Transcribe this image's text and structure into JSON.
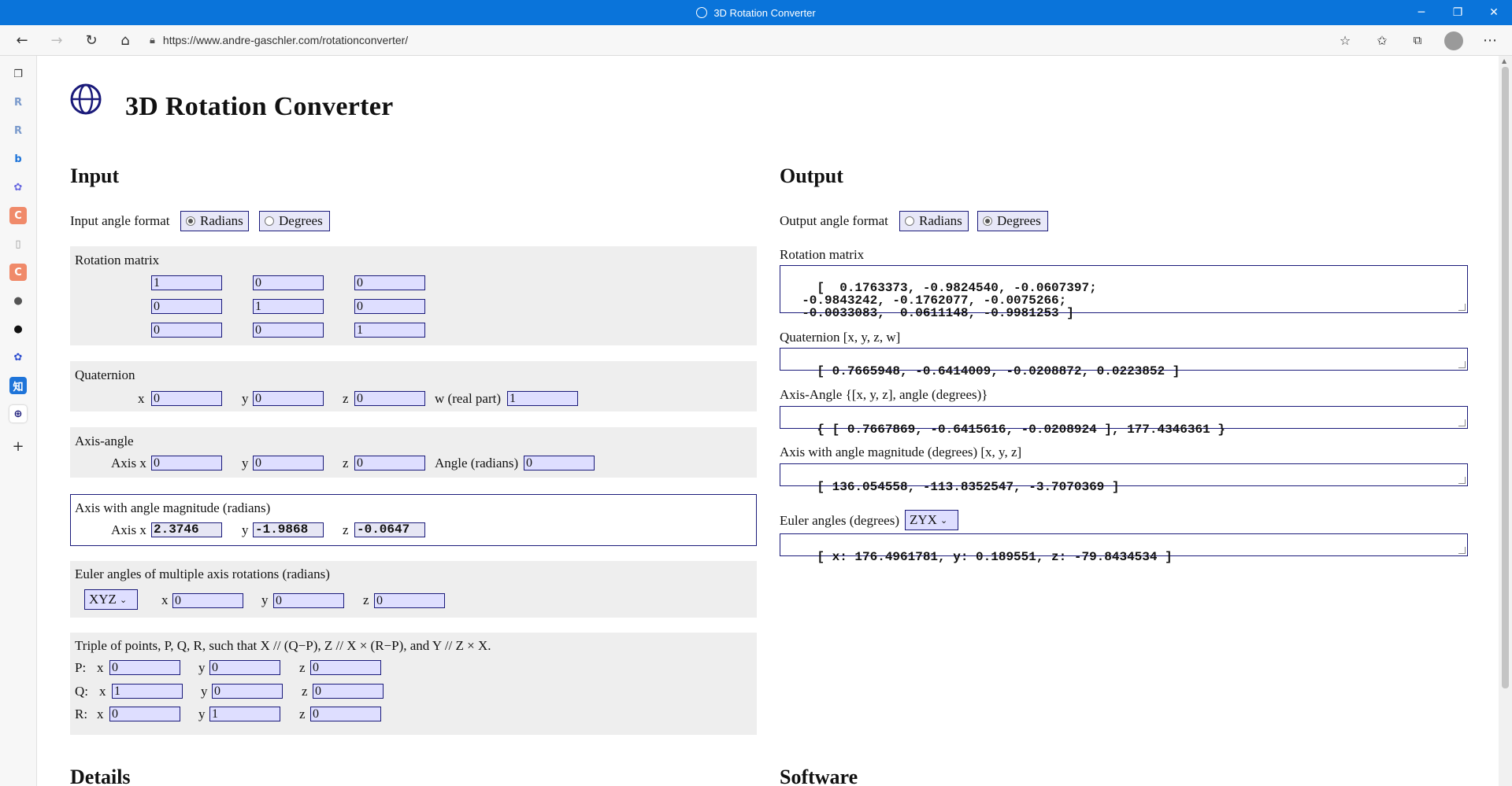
{
  "window": {
    "title": "3D Rotation Converter",
    "minimize": "─",
    "restore": "❐",
    "close": "✕"
  },
  "browser": {
    "url": "https://www.andre-gaschler.com/rotationconverter/"
  },
  "page": {
    "title": "3D Rotation Converter",
    "input": {
      "heading": "Input",
      "angle_format_label": "Input angle format",
      "radians": "Radians",
      "degrees": "Degrees",
      "rotation_matrix": {
        "label": "Rotation matrix",
        "values": [
          [
            "1",
            "0",
            "0"
          ],
          [
            "0",
            "1",
            "0"
          ],
          [
            "0",
            "0",
            "1"
          ]
        ]
      },
      "quaternion": {
        "label": "Quaternion",
        "x_label": "x",
        "y_label": "y",
        "z_label": "z",
        "w_label": "w (real part)",
        "x": "0",
        "y": "0",
        "z": "0",
        "w": "1"
      },
      "axis_angle": {
        "label": "Axis-angle",
        "x_label": "Axis x",
        "y_label": "y",
        "z_label": "z",
        "angle_label": "Angle (radians)",
        "x": "0",
        "y": "0",
        "z": "0",
        "angle": "0"
      },
      "axis_magnitude": {
        "label": "Axis with angle magnitude (radians)",
        "x_label": "Axis x",
        "y_label": "y",
        "z_label": "z",
        "x": "2.3746",
        "y": "-1.9868",
        "z": "-0.0647"
      },
      "euler": {
        "label": "Euler angles of multiple axis rotations (radians)",
        "order": "XYZ",
        "x_label": "x",
        "y_label": "y",
        "z_label": "z",
        "x": "0",
        "y": "0",
        "z": "0"
      },
      "triple": {
        "label": "Triple of points, P, Q, R, such that X  //  (Q−P),   Z  //  X × (R−P),  and Y  //  Z × X.",
        "rows": [
          {
            "name": "P:",
            "x": "0",
            "y": "0",
            "z": "0"
          },
          {
            "name": "Q:",
            "x": "1",
            "y": "0",
            "z": "0"
          },
          {
            "name": "R:",
            "x": "0",
            "y": "1",
            "z": "0"
          }
        ],
        "x_label": "x",
        "y_label": "y",
        "z_label": "z"
      }
    },
    "output": {
      "heading": "Output",
      "angle_format_label": "Output angle format",
      "radians": "Radians",
      "degrees": "Degrees",
      "rotation_matrix_label": "Rotation matrix",
      "rotation_matrix": "[  0.1763373, -0.9824540, -0.0607397;\n  -0.9843242, -0.1762077, -0.0075266;\n  -0.0033083,  0.0611148, -0.9981253 ]",
      "quaternion_label": "Quaternion [x, y, z, w]",
      "quaternion": "[ 0.7665948, -0.6414009, -0.0208872, 0.0223852 ]",
      "axis_angle_label": "Axis-Angle {[x, y, z], angle (degrees)}",
      "axis_angle": "{ [ 0.7667869, -0.6415616, -0.0208924 ], 177.4346361 }",
      "axis_magnitude_label": "Axis with angle magnitude (degrees) [x, y, z]",
      "axis_magnitude": "[ 136.054558, -113.8352547, -3.7070369 ]",
      "euler_label": "Euler angles (degrees)",
      "euler_order": "ZYX",
      "euler": "[ x: 176.4961781, y: 0.189551, z: -79.8434534 ]"
    },
    "details_heading": "Details",
    "software_heading": "Software"
  }
}
